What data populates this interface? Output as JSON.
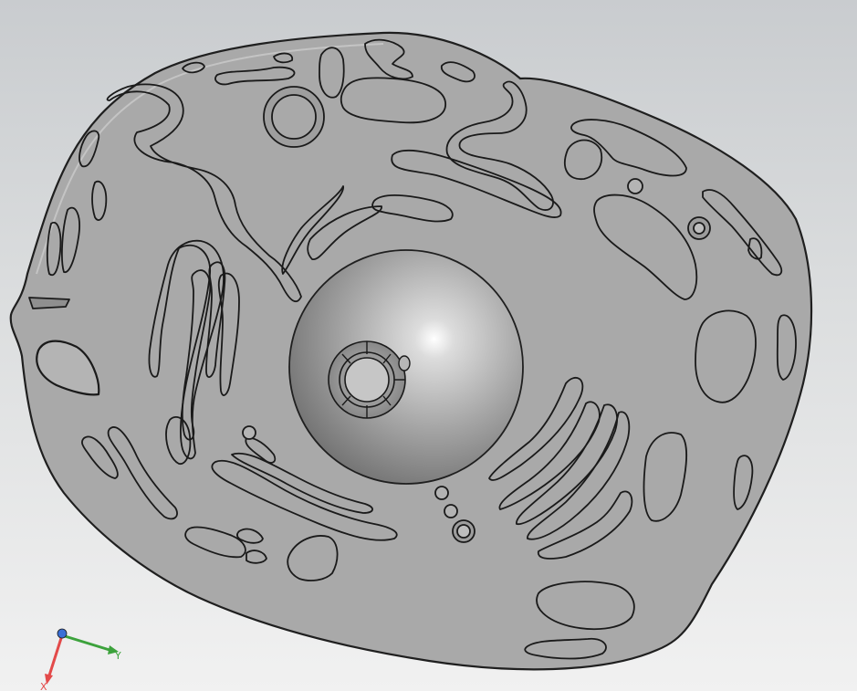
{
  "viewport": {
    "background_top": "#c9cccf",
    "background_bottom": "#f1f1f1",
    "model_fill": "#a9a9a9",
    "edge_color": "#1f1f1f"
  },
  "triad": {
    "x_label": "X",
    "y_label": "Y",
    "x_color": "#e34a4a",
    "y_color": "#3ca23c",
    "z_color": "#3a6fd6"
  }
}
